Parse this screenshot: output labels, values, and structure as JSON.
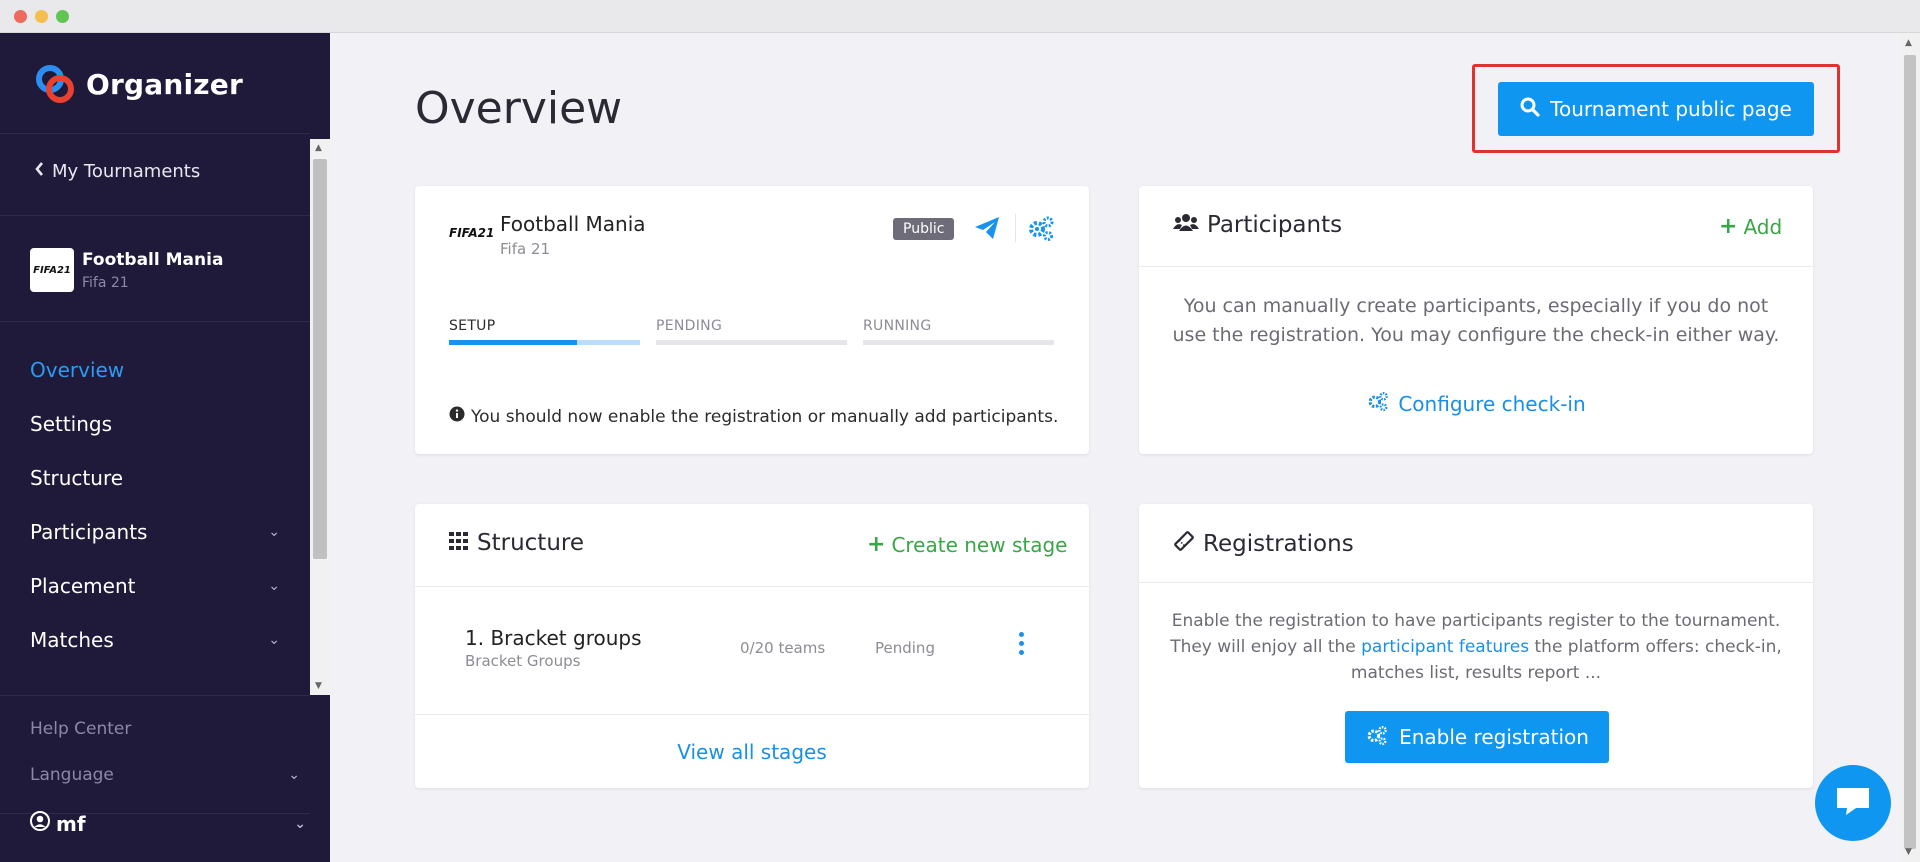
{
  "sidebar": {
    "brand": "Organizer",
    "back_label": "My Tournaments",
    "tournament": {
      "name": "Football Mania",
      "game": "Fifa 21",
      "logo_text": "FIFA21"
    },
    "nav": [
      {
        "label": "Overview",
        "active": true,
        "has_chevron": false
      },
      {
        "label": "Settings",
        "active": false,
        "has_chevron": false
      },
      {
        "label": "Structure",
        "active": false,
        "has_chevron": false
      },
      {
        "label": "Participants",
        "active": false,
        "has_chevron": true
      },
      {
        "label": "Placement",
        "active": false,
        "has_chevron": true
      },
      {
        "label": "Matches",
        "active": false,
        "has_chevron": true
      }
    ],
    "help_center": "Help Center",
    "language": "Language",
    "user": "mf"
  },
  "main": {
    "title": "Overview",
    "public_page_button": "Tournament public page",
    "info_card": {
      "logo_text": "FIFA21",
      "name": "Football Mania",
      "game": "Fifa 21",
      "badge": "Public",
      "steps": [
        {
          "label": "SETUP",
          "progress": 0.67,
          "active": true
        },
        {
          "label": "PENDING",
          "progress": 0,
          "active": false
        },
        {
          "label": "RUNNING",
          "progress": 0,
          "active": false
        }
      ],
      "note": "You should now enable the registration or manually add participants."
    },
    "participants_card": {
      "title": "Participants",
      "add_label": "Add",
      "description": "You can manually create participants, especially if you do not use the registration. You may configure the check-in either way.",
      "configure_label": "Configure check-in"
    },
    "structure_card": {
      "title": "Structure",
      "create_label": "Create new stage",
      "stage": {
        "name": "1. Bracket groups",
        "type": "Bracket Groups",
        "teams": "0/20 teams",
        "status": "Pending"
      },
      "view_all_label": "View all stages"
    },
    "registrations_card": {
      "title": "Registrations",
      "desc_before": "Enable the registration to have participants register to the tournament. They will enjoy all the ",
      "desc_link": "participant features",
      "desc_after": " the platform offers: check-in, matches list, results report ...",
      "enable_label": "Enable registration"
    }
  },
  "colors": {
    "sidebar_bg": "#1f1a3a",
    "accent_blue": "#0f96f1",
    "green": "#3aa648",
    "highlight_red": "#e0332e"
  }
}
